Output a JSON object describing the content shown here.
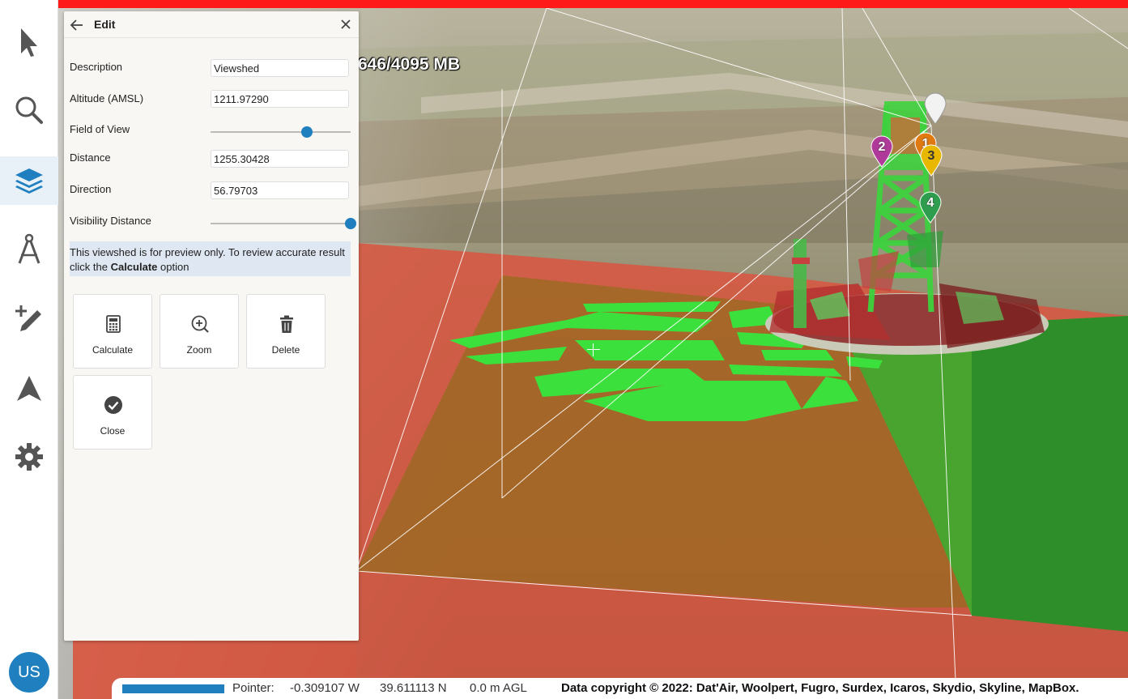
{
  "scene": {
    "memory_readout": "646/4095 MB",
    "markers": [
      {
        "label": "2",
        "color": "#b03a9a"
      },
      {
        "label": "1",
        "color": "#e07a10"
      },
      {
        "label": "3",
        "color": "#e8b800"
      },
      {
        "label": "4",
        "color": "#2e9e4e"
      }
    ]
  },
  "sidebar": {
    "items": [
      {
        "icon": "pointer-icon"
      },
      {
        "icon": "search-icon"
      },
      {
        "icon": "layers-icon"
      },
      {
        "icon": "compass-drafting-icon"
      },
      {
        "icon": "add-draw-icon"
      },
      {
        "icon": "navigate-icon"
      },
      {
        "icon": "gear-icon"
      }
    ],
    "active_index": 2,
    "avatar_initials": "US",
    "accent": "#1f7fbf"
  },
  "panel": {
    "title": "Edit",
    "fields": {
      "description_label": "Description",
      "description_value": "Viewshed",
      "altitude_label": "Altitude (AMSL)",
      "altitude_value": "1211.97290",
      "fov_label": "Field of View",
      "fov_level": 0.69,
      "distance_label": "Distance",
      "distance_value": "1255.30428",
      "direction_label": "Direction",
      "direction_value": "56.79703",
      "visibility_label": "Visibility Distance",
      "visibility_level": 1.0
    },
    "note_text": "This viewshed is for preview only. To review accurate result click the ",
    "note_bold": "Calculate",
    "note_suffix": " option",
    "actions": {
      "calculate": "Calculate",
      "zoom": "Zoom",
      "delete": "Delete",
      "close": "Close"
    }
  },
  "status": {
    "pointer_label": "Pointer:",
    "longitude": "-0.309107 W",
    "latitude": "39.611113 N",
    "altitude": "0.0 m AGL",
    "copyright": "Data copyright © 2022: Dat'Air, Woolpert, Fugro, Surdex, Icaros, Skydio, Skyline, MapBox."
  }
}
